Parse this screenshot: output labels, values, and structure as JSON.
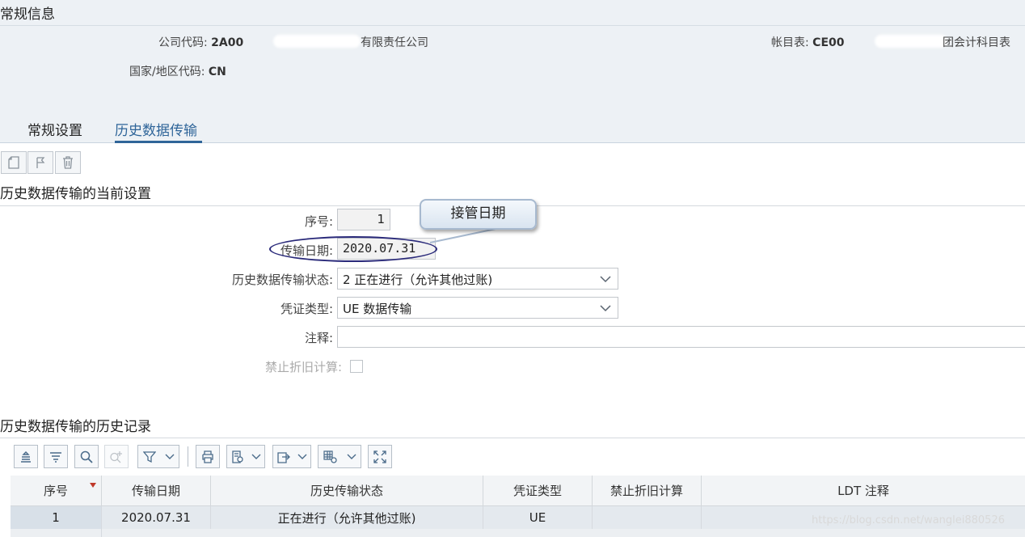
{
  "header": {
    "title": "常规信息",
    "company_code_label": "公司代码:",
    "company_code": "2A00",
    "company_name_visible": "有限责任公司",
    "chart_label": "帐目表:",
    "chart_code": "CE00",
    "chart_name_visible": "团会计科目表",
    "country_label": "国家/地区代码:",
    "country_code": "CN"
  },
  "tabs": [
    {
      "label": "常规设置"
    },
    {
      "label": "历史数据传输"
    }
  ],
  "current_settings": {
    "title": "历史数据传输的当前设置",
    "seq_label": "序号:",
    "seq_value": "1",
    "date_label": "传输日期:",
    "date_value": "2020.07.31",
    "status_label": "历史数据传输状态:",
    "status_value": "2 正在进行（允许其他过账)",
    "voucher_label": "凭证类型:",
    "voucher_value": "UE 数据传输",
    "note_label": "注释:",
    "note_value": "",
    "no_depr_label": "禁止折旧计算:",
    "no_depr_checked": false
  },
  "callout": {
    "text": "接管日期"
  },
  "history": {
    "title": "历史数据传输的历史记录",
    "columns": [
      "序号",
      "传输日期",
      "历史传输状态",
      "凭证类型",
      "禁止折旧计算",
      "LDT 注释"
    ],
    "rows": [
      [
        "1",
        "2020.07.31",
        "正在进行（允许其他过账)",
        "UE",
        "",
        ""
      ]
    ]
  },
  "watermark": "https://blog.csdn.net/wanglei880526",
  "colors": {
    "accent": "#2f6599",
    "header_bg": "#edf1f5",
    "sort_marker": "#c0392b",
    "ellipse": "#2a2a7a"
  }
}
